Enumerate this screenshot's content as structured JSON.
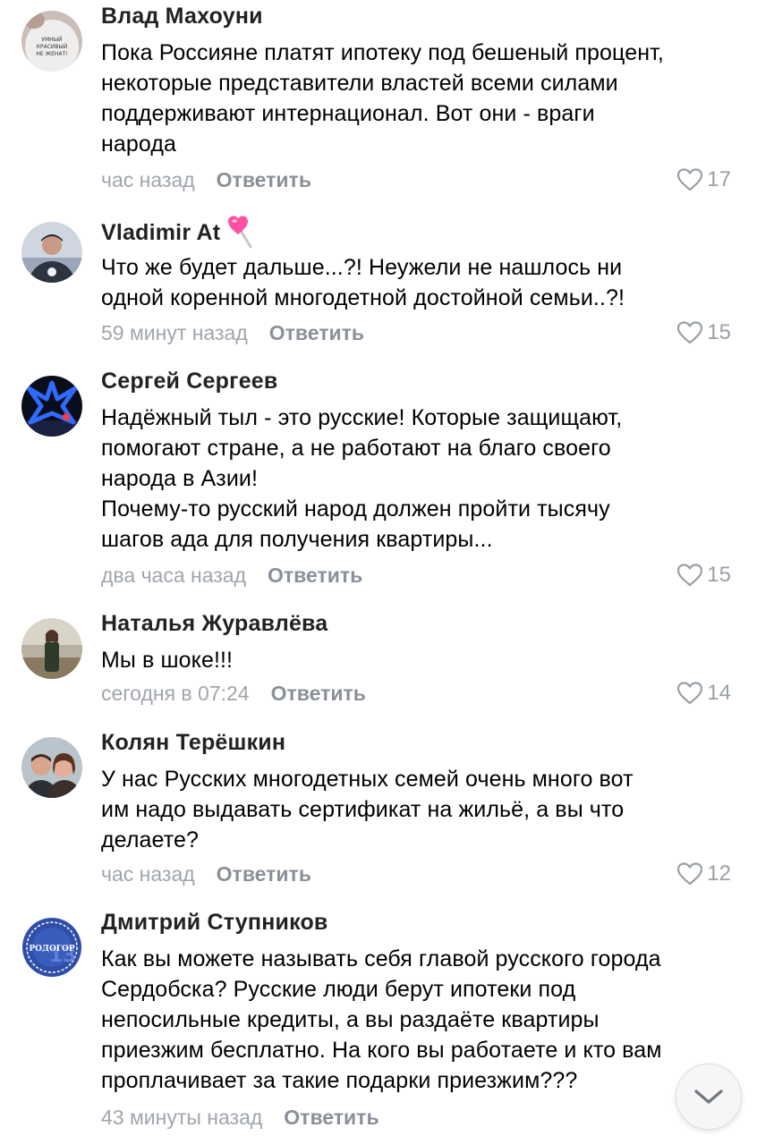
{
  "comments": [
    {
      "author": "Влад Махоуни",
      "avatar": "avatar-text-shirt",
      "text": "Пока Россияне платят ипотеку под бешеный процент,\nнекоторые представители властей всеми силами\nподдерживают интернационал. Вот они - враги\nнарода",
      "time": "час назад",
      "reply": "Ответить",
      "likes": "17"
    },
    {
      "author": "Vladimir At",
      "avatar": "avatar-man-cap",
      "badge": "lollipop-heart-icon",
      "text": "Что же будет дальше...?! Неужели не нашлось ни\nодной коренной многодетной достойной семьи..?!",
      "time": "59 минут назад",
      "reply": "Ответить",
      "likes": "15"
    },
    {
      "author": "Сергей Сергеев",
      "avatar": "avatar-blue-star",
      "text": "Надёжный тыл - это русские! Которые защищают,\nпомогают стране, а не работают на благо своего\nнарода в Азии!\nПочему-то русский народ должен пройти тысячу\nшагов ада для получения квартиры...",
      "time": "два часа назад",
      "reply": "Ответить",
      "likes": "15"
    },
    {
      "author": "Наталья Журавлёва",
      "avatar": "avatar-woman-outdoor",
      "text": "Мы в шоке!!!",
      "time": "сегодня в 07:24",
      "reply": "Ответить",
      "likes": "14"
    },
    {
      "author": "Колян Терёшкин",
      "avatar": "avatar-couple",
      "text": "У нас Русских многодетных семей очень много вот\nим надо выдавать сертификат на жильё, а вы что\nделаете?",
      "time": "час назад",
      "reply": "Ответить",
      "likes": "12"
    },
    {
      "author": "Дмитрий Ступников",
      "avatar": "avatar-rodogor-logo",
      "avatar_text": "РОДОГОР",
      "text": "Как вы можете называть себя главой русского города\nСердобска? Русские люди берут ипотеки под\nнепосильные кредиты, а вы раздаёте квартиры\nприезжим бесплатно. На кого вы работаете и кто вам\nпроплачивает за такие подарки приезжим???",
      "time": "43 минуты назад",
      "reply": "Ответить",
      "likes": ""
    }
  ],
  "icons": {
    "like": "heart-outline-icon",
    "scroll": "chevron-down-icon"
  },
  "colors": {
    "meta": "#a0a5ad",
    "reply": "#8a9099",
    "accent_logo": "#2f4ea8"
  }
}
